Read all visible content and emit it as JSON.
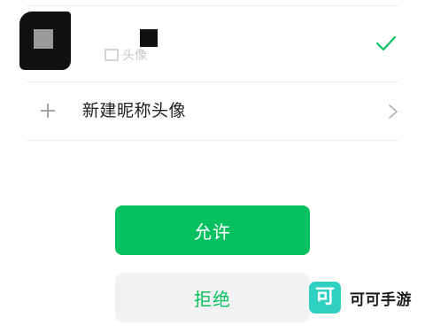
{
  "identity_list": {
    "selected_identity": {
      "label": "头像",
      "selected": true,
      "icons": {
        "check": "check-icon"
      }
    },
    "new_identity": {
      "label": "新建昵称头像",
      "icons": {
        "leading": "plus-icon",
        "trailing": "chevron-right-icon"
      }
    }
  },
  "actions": {
    "allow_label": "允许",
    "reject_label": "拒绝"
  },
  "watermark": {
    "logo_char": "可",
    "text": "可可手游"
  },
  "colors": {
    "accent": "#07c160",
    "reject_bg": "#f2f2f2",
    "divider": "#ececec",
    "watermark_logo": "#2fd0c2"
  }
}
